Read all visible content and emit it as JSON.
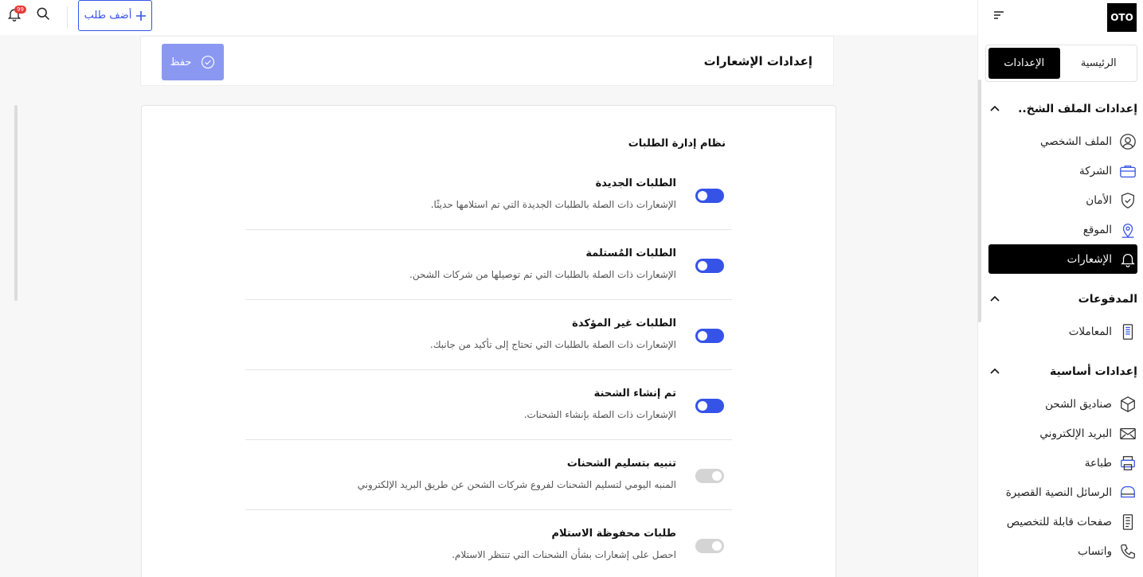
{
  "topbar": {
    "notification_count": "99",
    "add_order_label": "أضف طلب"
  },
  "sidebar": {
    "logo": "OTO",
    "tabs": [
      {
        "label": "الرئيسية",
        "active": false
      },
      {
        "label": "الإعدادات",
        "active": true
      }
    ],
    "sections": [
      {
        "title": "إعدادات الملف الشخ..",
        "items": [
          {
            "label": "الملف الشخصي",
            "icon": "user-circle-icon"
          },
          {
            "label": "الشركة",
            "icon": "briefcase-icon"
          },
          {
            "label": "الأمان",
            "icon": "shield-check-icon"
          },
          {
            "label": "الموقع",
            "icon": "location-pin-icon"
          },
          {
            "label": "الإشعارات",
            "icon": "bell-icon",
            "active": true
          }
        ]
      },
      {
        "title": "المدفوعات",
        "items": [
          {
            "label": "المعاملات",
            "icon": "receipt-icon"
          }
        ]
      },
      {
        "title": "إعدادات أساسية",
        "items": [
          {
            "label": "صناديق الشحن",
            "icon": "box-icon"
          },
          {
            "label": "البريد الإلكتروني",
            "icon": "envelope-icon"
          },
          {
            "label": "طباعة",
            "icon": "printer-icon"
          },
          {
            "label": "الرسائل النصية القصيرة",
            "icon": "chat-bubble-icon"
          },
          {
            "label": "صفحات قابلة للتخصيص",
            "icon": "document-icon"
          },
          {
            "label": "واتساب",
            "icon": "phone-icon"
          }
        ]
      }
    ]
  },
  "header": {
    "title": "إعدادات الإشعارات",
    "save_label": "حفظ"
  },
  "notifications": {
    "section_title": "نظام إدارة الطلبات",
    "rows": [
      {
        "title": "الطلبات الجديدة",
        "description": "الإشعارات ذات الصلة بالطلبات الجديدة التي تم استلامها حديثًا.",
        "enabled": true
      },
      {
        "title": "الطلبات المُستلمة",
        "description": "الإشعارات ذات الصلة بالطلبات التي تم توصيلها من شركات الشحن.",
        "enabled": true
      },
      {
        "title": "الطلبات غير المؤكدة",
        "description": "الإشعارات ذات الصلة بالطلبات التي تحتاج إلى تأكيد من جانبك.",
        "enabled": true
      },
      {
        "title": "تم إنشاء الشحنة",
        "description": "الإشعارات ذات الصلة بإنشاء الشحنات.",
        "enabled": true
      },
      {
        "title": "تنبيه بتسليم الشحنات",
        "description": "المنبه اليومي لتسليم الشحنات لفروع شركات الشحن عن طريق البريد الإلكتروني",
        "enabled": false
      },
      {
        "title": "طلبات محفوظة الاستلام",
        "description": "احصل على إشعارات بشأن الشحنات التي تنتظر الاستلام.",
        "enabled": false
      }
    ]
  },
  "colors": {
    "accent": "#3653e8",
    "save_disabled": "#8b98f2",
    "badge": "#e53935"
  }
}
